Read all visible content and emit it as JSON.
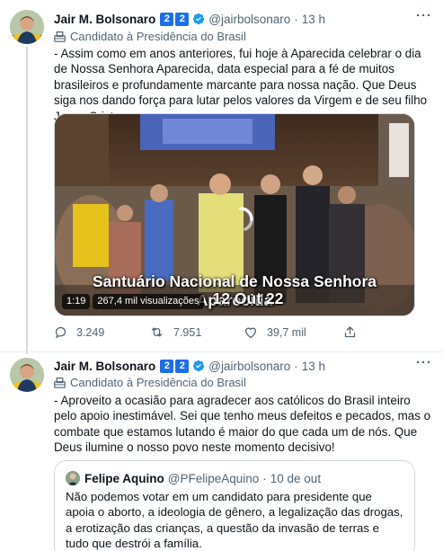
{
  "tweets": [
    {
      "author_name": "Jair M. Bolsonaro",
      "badges": [
        "2",
        "2"
      ],
      "handle": "@jairbolsonaro",
      "time": "13 h",
      "label": "Candidato à Presidência do Brasil",
      "text": "- Assim como em anos anteriores, fui hoje à Aparecida celebrar o dia de Nossa Senhora Aparecida, data especial para a fé de muitos brasileiros e profundamente marcante para nossa nação. Que Deus siga nos dando força para lutar pelos valores da Virgem e de seu filho Jesus Cristo.",
      "video": {
        "caption_line1": "Santuário Nacional de Nossa Senhora Aparecida",
        "caption_line2": "12 Out 22",
        "duration": "1:19",
        "views": "267,4 mil visualizações"
      },
      "actions": {
        "replies": "3.249",
        "retweets": "7.951",
        "likes": "39,7 mil"
      }
    },
    {
      "author_name": "Jair M. Bolsonaro",
      "badges": [
        "2",
        "2"
      ],
      "handle": "@jairbolsonaro",
      "time": "13 h",
      "label": "Candidato à Presidência do Brasil",
      "text": "- Aproveito a ocasião para agradecer aos católicos do Brasil inteiro pelo apoio inestimável. Sei que tenho meus defeitos e pecados, mas o combate que estamos lutando é maior do que cada um de nós. Que Deus ilumine o nosso povo neste momento decisivo!",
      "quote": {
        "author_name": "Felipe Aquino",
        "handle": "@PFelipeAquino",
        "date": "10 de out",
        "text": "Não podemos votar em um candidato para presidente que apoia o aborto, a ideologia de gênero, a legalização das drogas, a erotização das crianças,  a questão da invasão de terras e tudo que destrói a família."
      }
    }
  ],
  "colors": {
    "text": "#0f1419",
    "secondary": "#536471",
    "verified": "#1d9bf0",
    "badge": "#1d6fe8",
    "border": "#cfd9de"
  }
}
